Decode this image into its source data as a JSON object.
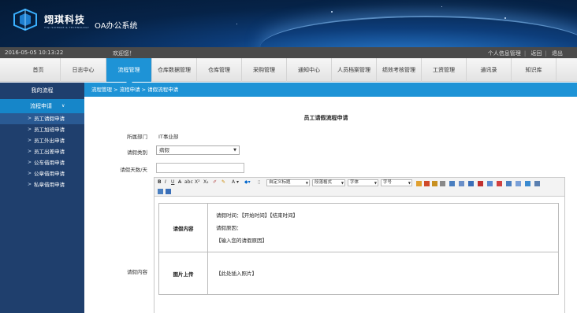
{
  "header": {
    "brand_cn": "翊琪科技",
    "brand_en": "YIQI SCIENCE & TECHNOLOGY",
    "system_title": "OA办公系统"
  },
  "infobar": {
    "datetime": "2016-05-05 10:13:22",
    "welcome": "欢迎您！",
    "links": [
      "个人信息管理",
      "返回",
      "退出"
    ]
  },
  "nav": {
    "items": [
      "首页",
      "日志中心",
      "流程管理",
      "仓库数据管理",
      "仓库管理",
      "采购管理",
      "通知中心",
      "人员档案管理",
      "绩效考核管理",
      "工资管理",
      "通讯录",
      "知识库"
    ],
    "active": "流程管理"
  },
  "sidebar": {
    "heading": "我的流程",
    "group": "流程申请",
    "items": [
      "员工请假申请",
      "员工加班申请",
      "员工外出申请",
      "员工出差申请",
      "公车借用申请",
      "公章借用申请",
      "私章借用申请"
    ],
    "active": "员工请假申请"
  },
  "breadcrumb": "流程管理 > 流程申请 > 请假流程申请",
  "form": {
    "title": "员工请假流程申请",
    "dept_label": "所属部门",
    "dept_value": "IT事业部",
    "type_label": "请假类别",
    "type_value": "病假",
    "days_label": "请假天数/天",
    "days_value": "",
    "content_label": "请假内容"
  },
  "toolbar": {
    "style_dd": "自定义标题",
    "para_dd": "段落格式",
    "font_dd": "字体",
    "size_dd": "字号"
  },
  "doc": {
    "row1_head": "请假内容",
    "row1_lines": [
      "请假时间：【开始时间】【结束时间】",
      "请假原因：",
      "【输入您的请假原因】"
    ],
    "row2_head": "图片上传",
    "row2_line": "【此处插入照片】"
  },
  "colors": {
    "accent": "#1e93d6",
    "sidebar_bg": "#1f3f6d",
    "infobar_bg": "#4a4a4a"
  }
}
